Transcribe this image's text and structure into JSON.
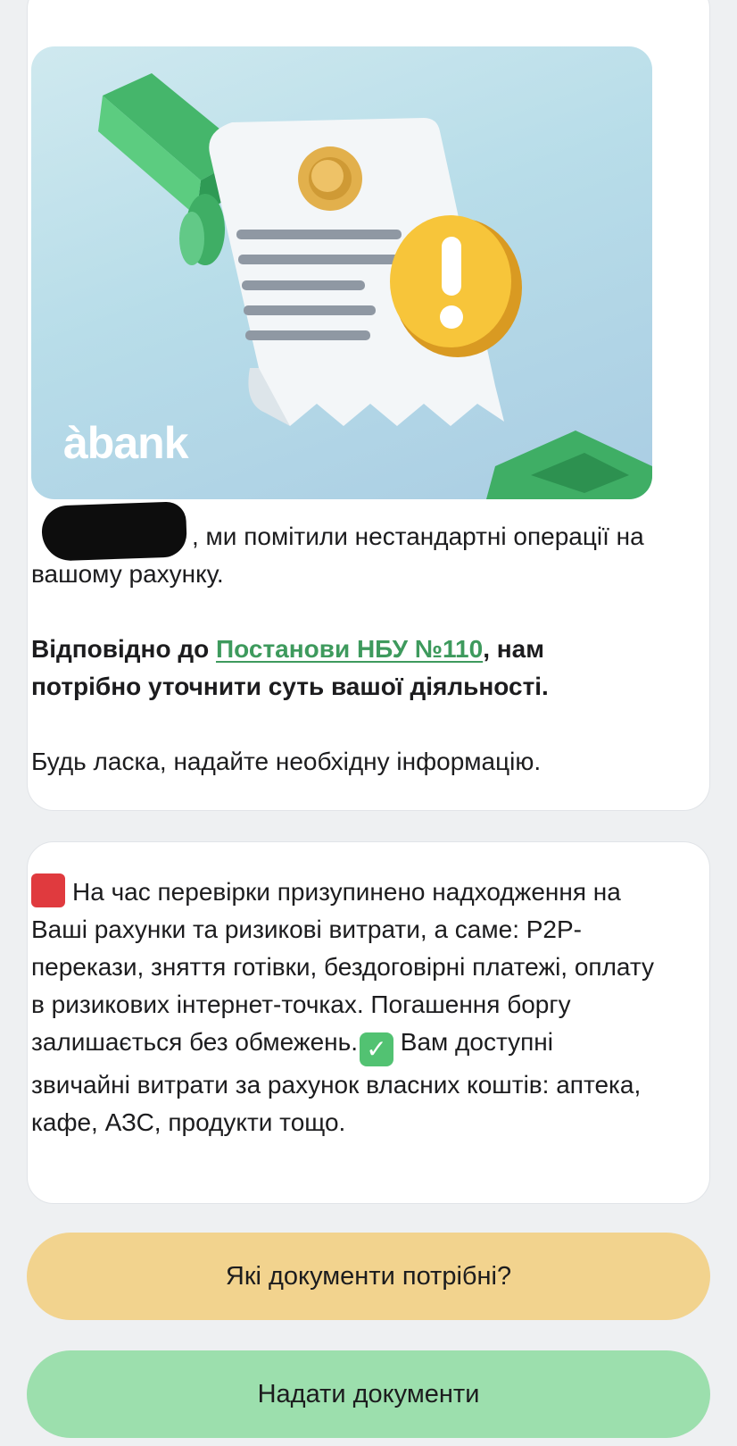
{
  "banner": {
    "brand": "àbank"
  },
  "message": {
    "greeting_text": ", ми помітили нестандартні операції на вашому рахунку.",
    "legal_prefix": "Відповідно до ",
    "legal_link": "Постанови НБУ №110",
    "legal_suffix": ", нам потрібно уточнити суть вашої діяльності.",
    "request": "Будь ласка, надайте необхідну інформацію."
  },
  "notice": {
    "part1": "На час перевірки призупинено надходження на Ваші рахунки та ризикові витрати, а саме: P2P-перекази, зняття готівки, бездоговірні платежі, оплату в ризикових інтернет-точках. Погашення боргу залишається без обмежень.",
    "check_mark": "✓",
    "part2": "Вам доступні звичайні витрати за рахунок власних коштів: аптека, кафе, АЗС, продукти тощо."
  },
  "buttons": {
    "documents_needed": "Які документи потрібні?",
    "submit_documents": "Надати документи"
  },
  "colors": {
    "link": "#3e9a5d",
    "button_yellow": "#f2d38e",
    "button_green": "#9cdfad",
    "alert_red": "#e03a3e",
    "check_green": "#52c272"
  }
}
